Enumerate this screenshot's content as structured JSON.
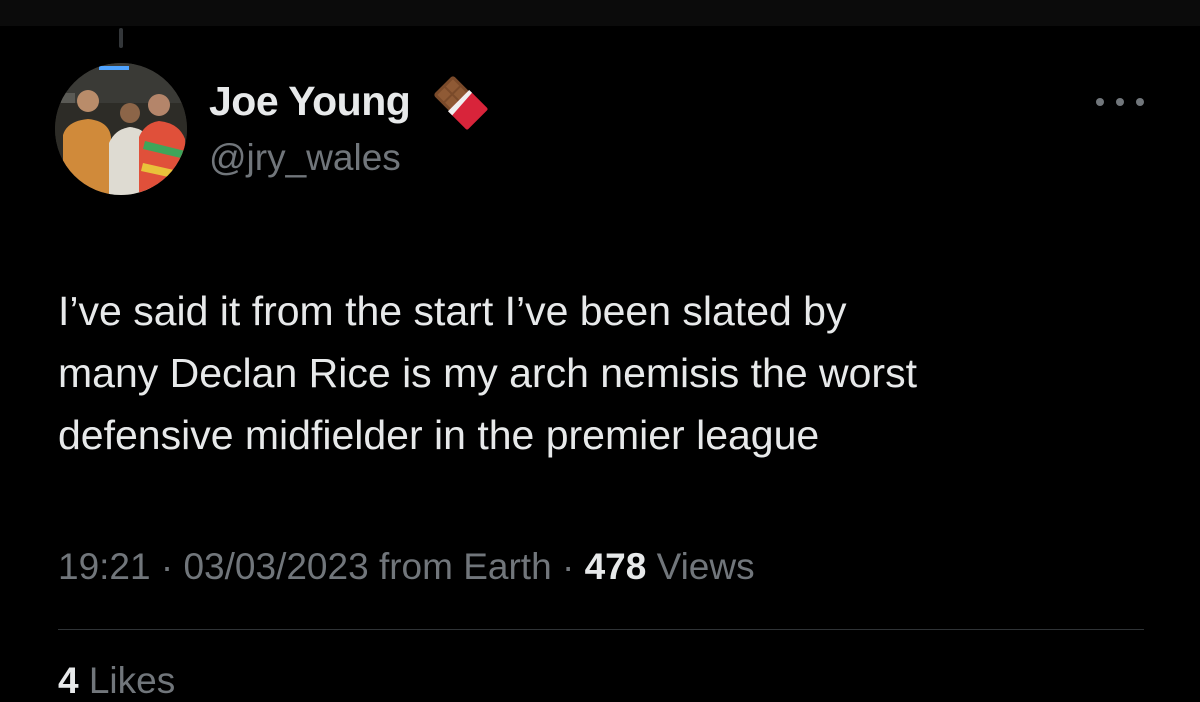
{
  "author": {
    "display_name": "Joe Young",
    "handle": "@jry_wales",
    "badge_icon": "chocolate-bar-icon"
  },
  "more_icon": "more-options-icon",
  "tweet": {
    "lines": [
      "I’ve said it from the start I’ve been slated by",
      "many Declan Rice is my arch nemisis the worst",
      "defensive midfielder in the premier league"
    ]
  },
  "meta": {
    "time": "19:21",
    "sep1": " · ",
    "date": "03/03/2023",
    "source": " from Earth",
    "sep2": " · ",
    "views_count": "478",
    "views_label": " Views"
  },
  "engagement": {
    "likes_count": "4",
    "likes_label": " Likes"
  },
  "colors": {
    "background": "#000000",
    "text_primary": "#e7e9ea",
    "text_secondary": "#71767b",
    "divider": "#2f3336"
  }
}
